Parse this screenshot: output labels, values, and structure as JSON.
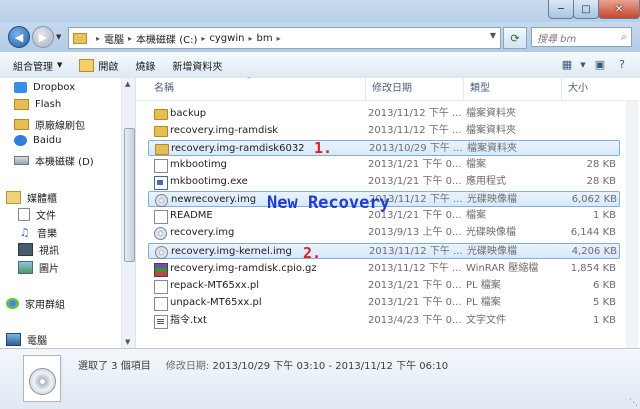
{
  "address": {
    "crumbs": [
      "電腦",
      "本機磁碟 (C:)",
      "cygwin",
      "bm"
    ],
    "search_placeholder": "搜尋 bm"
  },
  "toolbar": {
    "organize": "組合管理",
    "open": "開啟",
    "burn": "燒錄",
    "new_folder": "新增資料夾"
  },
  "sidebar": {
    "items": [
      {
        "label": "Dropbox"
      },
      {
        "label": "Flash"
      },
      {
        "label": "原廠線刷包"
      },
      {
        "label": "Baidu"
      },
      {
        "label": "本機磁碟 (D)"
      },
      {
        "label": "媒體櫃"
      },
      {
        "label": "文件"
      },
      {
        "label": "音樂"
      },
      {
        "label": "視訊"
      },
      {
        "label": "圖片"
      },
      {
        "label": "家用群組"
      },
      {
        "label": "電腦"
      }
    ]
  },
  "columns": {
    "name": "名稱",
    "date": "修改日期",
    "type": "類型",
    "size": "大小"
  },
  "files": [
    {
      "name": "backup",
      "date": "2013/11/12 下午 ...",
      "type": "檔案資料夾",
      "size": "",
      "icon": "folder-icon",
      "selected": false
    },
    {
      "name": "recovery.img-ramdisk",
      "date": "2013/11/12 下午 ...",
      "type": "檔案資料夾",
      "size": "",
      "icon": "folder-icon",
      "selected": false
    },
    {
      "name": "recovery.img-ramdisk6032",
      "date": "2013/10/29 下午 ...",
      "type": "檔案資料夾",
      "size": "",
      "icon": "folder-icon",
      "selected": true
    },
    {
      "name": "mkbootimg",
      "date": "2013/1/21 下午 0...",
      "type": "檔案",
      "size": "28 KB",
      "icon": "file-icon",
      "selected": false
    },
    {
      "name": "mkbootimg.exe",
      "date": "2013/1/21 下午 0...",
      "type": "應用程式",
      "size": "28 KB",
      "icon": "exe-icon",
      "selected": false
    },
    {
      "name": "newrecovery.img",
      "date": "2013/11/12 下午 ...",
      "type": "光碟映像檔",
      "size": "6,062 KB",
      "icon": "disc-image-icon",
      "selected": true
    },
    {
      "name": "README",
      "date": "2013/1/21 下午 0...",
      "type": "檔案",
      "size": "1 KB",
      "icon": "file-icon",
      "selected": false
    },
    {
      "name": "recovery.img",
      "date": "2013/9/13 上午 0...",
      "type": "光碟映像檔",
      "size": "6,144 KB",
      "icon": "disc-image-icon",
      "selected": false
    },
    {
      "name": "recovery.img-kernel.img",
      "date": "2013/11/12 下午 ...",
      "type": "光碟映像檔",
      "size": "4,206 KB",
      "icon": "disc-image-icon",
      "selected": true
    },
    {
      "name": "recovery.img-ramdisk.cpio.gz",
      "date": "2013/11/12 下午 ...",
      "type": "WinRAR 壓縮檔",
      "size": "1,854 KB",
      "icon": "winrar-icon",
      "selected": false
    },
    {
      "name": "repack-MT65xx.pl",
      "date": "2013/1/21 下午 0...",
      "type": "PL 檔案",
      "size": "6 KB",
      "icon": "file-icon",
      "selected": false
    },
    {
      "name": "unpack-MT65xx.pl",
      "date": "2013/1/21 下午 0...",
      "type": "PL 檔案",
      "size": "5 KB",
      "icon": "file-icon",
      "selected": false
    },
    {
      "name": "指令.txt",
      "date": "2013/4/23 下午 0...",
      "type": "文字文件",
      "size": "1 KB",
      "icon": "text-file-icon",
      "selected": false
    }
  ],
  "annotations": {
    "mark1": "1.",
    "mark2": "2.",
    "headline": "New Recovery"
  },
  "status": {
    "selected": "選取了 3 個項目",
    "date_label": "修改日期:",
    "date_range": "2013/10/29 下午 03:10 - 2013/11/12 下午 06:10"
  },
  "colors": {
    "selection": "#d7e9fb",
    "selection_border": "#84acdd",
    "annotation_red": "#e01e1e",
    "annotation_blue": "#1f3dd6"
  }
}
